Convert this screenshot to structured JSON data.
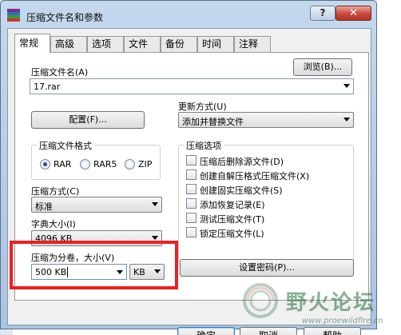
{
  "window": {
    "title": "压缩文件名和参数",
    "help_symbol": "?",
    "close_symbol": "✕"
  },
  "tabs": [
    {
      "label": "常规",
      "active": true
    },
    {
      "label": "高级"
    },
    {
      "label": "选项"
    },
    {
      "label": "文件"
    },
    {
      "label": "备份"
    },
    {
      "label": "时间"
    },
    {
      "label": "注释"
    }
  ],
  "archive_name": {
    "label": "压缩文件名(A)",
    "value": "17.rar",
    "browse_label": "浏览(B)..."
  },
  "profiles_label": "配置(F)...",
  "update_mode": {
    "label": "更新方式(U)",
    "value": "添加并替换文件"
  },
  "format": {
    "legend": "压缩文件格式",
    "options": [
      {
        "label": "RAR",
        "selected": true
      },
      {
        "label": "RAR5",
        "selected": false
      },
      {
        "label": "ZIP",
        "selected": false
      }
    ]
  },
  "method": {
    "label": "压缩方式(C)",
    "value": "标准"
  },
  "dictionary": {
    "label": "字典大小(I)",
    "value": "4096 KB"
  },
  "split": {
    "label": "压缩为分卷，大小(V)",
    "value": "500 KB",
    "unit": "KB"
  },
  "options": {
    "legend": "压缩选项",
    "items": [
      {
        "label": "压缩后删除源文件(D)",
        "checked": false
      },
      {
        "label": "创建自解压格式压缩文件(X)",
        "checked": false
      },
      {
        "label": "创建固实压缩文件(S)",
        "checked": false
      },
      {
        "label": "添加恢复记录(E)",
        "checked": false
      },
      {
        "label": "测试压缩文件(T)",
        "checked": false
      },
      {
        "label": "锁定压缩文件(L)",
        "checked": false
      }
    ]
  },
  "set_password_label": "设置密码(P)...",
  "footer": {
    "ok": "确定",
    "cancel": "取消",
    "help": "帮助"
  },
  "watermark": {
    "text": "野火论坛",
    "url": "www.proewildfire.cn"
  },
  "colors": {
    "highlight": "#ee2020",
    "title_bar": "#b4cce8",
    "close_button": "#c8473a"
  }
}
